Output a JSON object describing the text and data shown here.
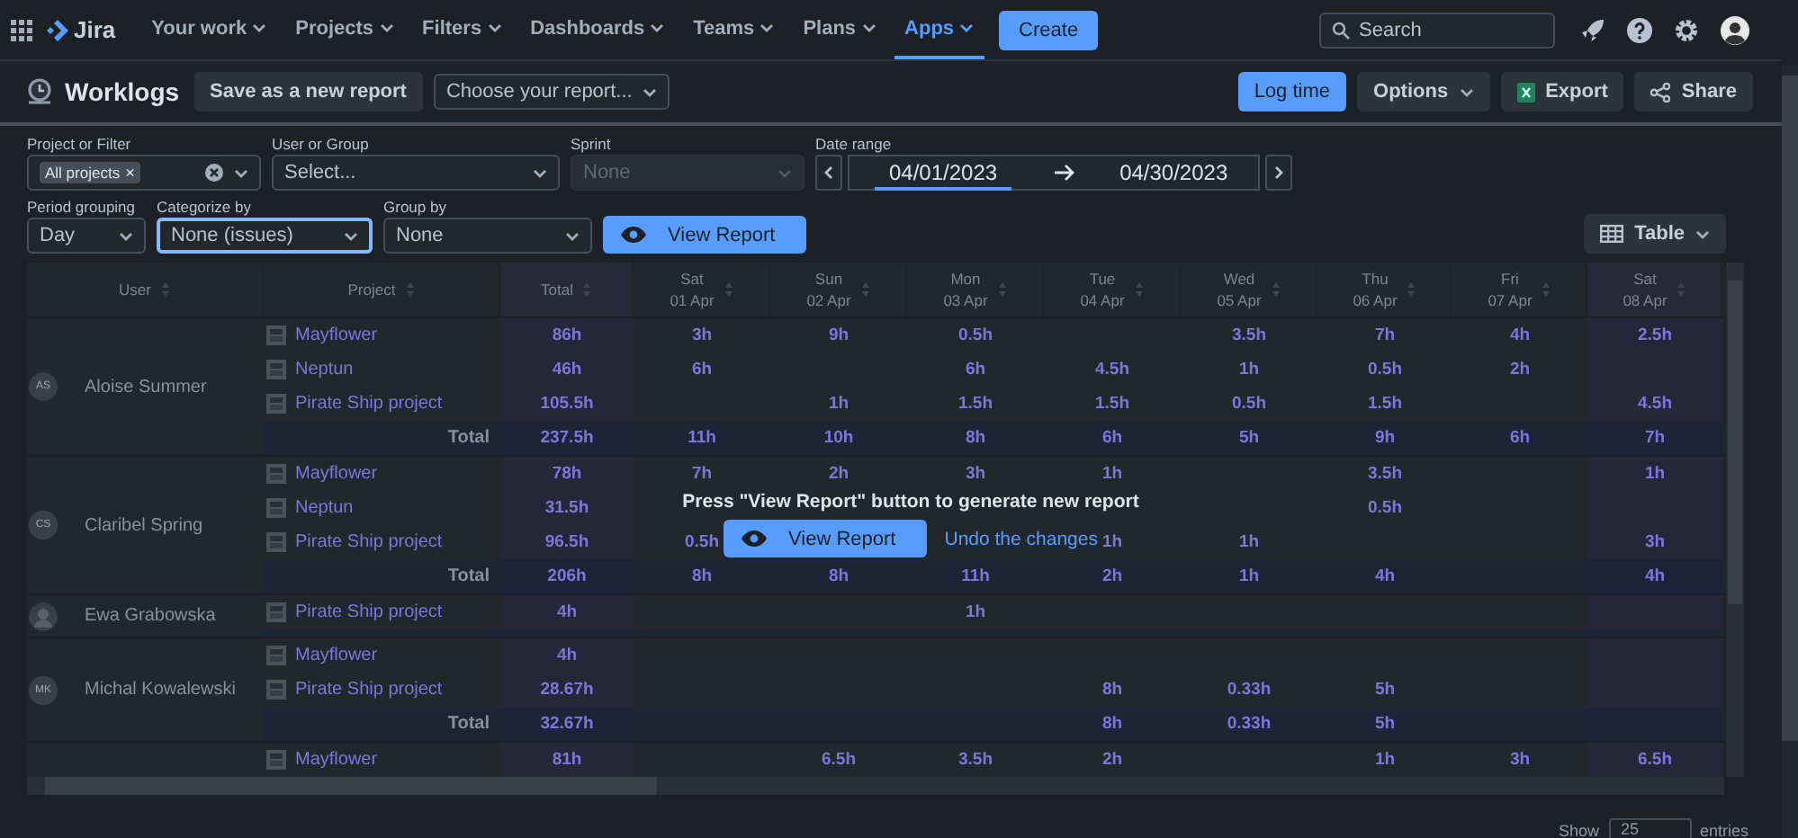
{
  "nav": {
    "product": "Jira",
    "items": [
      {
        "label": "Your work",
        "selected": false
      },
      {
        "label": "Projects",
        "selected": false
      },
      {
        "label": "Filters",
        "selected": false
      },
      {
        "label": "Dashboards",
        "selected": false
      },
      {
        "label": "Teams",
        "selected": false
      },
      {
        "label": "Plans",
        "selected": false
      },
      {
        "label": "Apps",
        "selected": true
      }
    ],
    "create": "Create",
    "search_placeholder": "Search"
  },
  "toolbar": {
    "title": "Worklogs",
    "save": "Save as a new report",
    "report_placeholder": "Choose your report...",
    "log_time": "Log time",
    "options": "Options",
    "export": "Export",
    "share": "Share"
  },
  "filters": [
    {
      "label": "Project or Filter",
      "kind": "tags",
      "tags": [
        {
          "label": "All projects",
          "remove": "×"
        }
      ],
      "disabled": false
    },
    {
      "label": "User or Group",
      "kind": "select",
      "placeholder": "Select...",
      "disabled": false
    },
    {
      "label": "Sprint",
      "kind": "select",
      "placeholder": "None",
      "disabled": true
    }
  ],
  "date_range": {
    "label": "Date range",
    "from": "04/01/2023",
    "to": "04/30/2023"
  },
  "filters2": [
    {
      "label": "Period grouping",
      "value": "Day",
      "focused": false
    },
    {
      "label": "Categorize by",
      "value": "None (issues)",
      "focused": true
    },
    {
      "label": "Group by",
      "value": "None",
      "focused": false
    }
  ],
  "view_report": "View Report",
  "view_mode": "Table",
  "table": {
    "columns": [
      {
        "label": "User",
        "highlight": false
      },
      {
        "label": "Project",
        "highlight": false
      },
      {
        "label": "Total",
        "highlight": true
      },
      {
        "label": "Sat",
        "sub": "01 Apr",
        "highlight": false
      },
      {
        "label": "Sun",
        "sub": "02 Apr",
        "highlight": false
      },
      {
        "label": "Mon",
        "sub": "03 Apr",
        "highlight": false
      },
      {
        "label": "Tue",
        "sub": "04 Apr",
        "highlight": false
      },
      {
        "label": "Wed",
        "sub": "05 Apr",
        "highlight": false
      },
      {
        "label": "Thu",
        "sub": "06 Apr",
        "highlight": false
      },
      {
        "label": "Fri",
        "sub": "07 Apr",
        "highlight": false
      },
      {
        "label": "Sat",
        "sub": "08 Apr",
        "highlight": true
      }
    ],
    "groups": [
      {
        "user": "Aloise Summer",
        "initials": "AS",
        "rows": [
          {
            "kind": "project",
            "project": "Mayflower",
            "cells": [
              "86h",
              "3h",
              "9h",
              "0.5h",
              "",
              "3.5h",
              "7h",
              "4h",
              "2.5h"
            ]
          },
          {
            "kind": "project",
            "project": "Neptun",
            "cells": [
              "46h",
              "6h",
              "",
              "6h",
              "4.5h",
              "1h",
              "0.5h",
              "2h",
              ""
            ]
          },
          {
            "kind": "project",
            "project": "Pirate Ship project",
            "cells": [
              "105.5h",
              "",
              "1h",
              "1.5h",
              "1.5h",
              "0.5h",
              "1.5h",
              "",
              "4.5h"
            ]
          },
          {
            "kind": "total",
            "project": "Total",
            "cells": [
              "237.5h",
              "11h",
              "10h",
              "8h",
              "6h",
              "5h",
              "9h",
              "6h",
              "7h"
            ]
          }
        ]
      },
      {
        "user": "Claribel Spring",
        "initials": "CS",
        "rows": [
          {
            "kind": "project",
            "project": "Mayflower",
            "cells": [
              "78h",
              "7h",
              "2h",
              "3h",
              "1h",
              "",
              "3.5h",
              "",
              "1h"
            ]
          },
          {
            "kind": "project",
            "project": "Neptun",
            "cells": [
              "31.5h",
              "",
              "",
              "",
              "",
              "",
              "0.5h",
              "",
              ""
            ]
          },
          {
            "kind": "project",
            "project": "Pirate Ship project",
            "cells": [
              "96.5h",
              "0.5h",
              "",
              "",
              "1h",
              "1h",
              "",
              "",
              "3h"
            ]
          },
          {
            "kind": "total",
            "project": "Total",
            "cells": [
              "206h",
              "8h",
              "8h",
              "11h",
              "2h",
              "1h",
              "4h",
              "",
              "4h"
            ]
          }
        ]
      },
      {
        "user": "Ewa Grabowska",
        "rows": [
          {
            "kind": "project",
            "project": "Pirate Ship project",
            "cells": [
              "4h",
              "",
              "",
              "1h",
              "",
              "",
              "",
              "",
              ""
            ]
          },
          {
            "kind": "band",
            "cells": []
          }
        ]
      },
      {
        "user": "Michal Kowalewski",
        "initials": "MK",
        "rows": [
          {
            "kind": "project",
            "project": "Mayflower",
            "cells": [
              "4h",
              "",
              "",
              "",
              "",
              "",
              "",
              "",
              ""
            ]
          },
          {
            "kind": "project",
            "project": "Pirate Ship project",
            "cells": [
              "28.67h",
              "",
              "",
              "",
              "8h",
              "0.33h",
              "5h",
              "",
              ""
            ]
          },
          {
            "kind": "total",
            "project": "Total",
            "cells": [
              "32.67h",
              "",
              "",
              "",
              "8h",
              "0.33h",
              "5h",
              "",
              ""
            ]
          }
        ]
      },
      {
        "rows": [
          {
            "kind": "project",
            "project": "Mayflower",
            "cells": [
              "81h",
              "",
              "6.5h",
              "3.5h",
              "2h",
              "",
              "1h",
              "3h",
              "6.5h"
            ]
          }
        ]
      }
    ]
  },
  "overlay": {
    "message": "Press \"View Report\" button to generate new report",
    "button": "View Report",
    "link": "Undo the changes"
  },
  "footer": {
    "show": "Show",
    "page_size": "25",
    "entries": "entries"
  }
}
